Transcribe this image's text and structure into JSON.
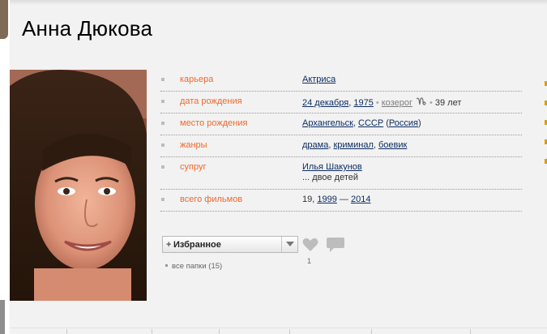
{
  "person": {
    "name": "Анна Дюкова"
  },
  "info": {
    "career": {
      "label": "карьера",
      "value": "Актриса"
    },
    "birth_date": {
      "label": "дата рождения",
      "day_month": "24 декабря",
      "year": "1975",
      "zodiac": "козерог",
      "age": "39 лет"
    },
    "birth_place": {
      "label": "место рождения",
      "city": "Архангельск",
      "country": "СССР",
      "country_now": "Россия"
    },
    "genres": {
      "label": "жанры",
      "items": [
        "драма",
        "криминал",
        "боевик"
      ]
    },
    "spouse": {
      "label": "супруг",
      "name": "Илья Шакунов",
      "children": "... двое детей"
    },
    "films_total": {
      "label": "всего фильмов",
      "count": "19",
      "year_from": "1999",
      "year_to": "2014"
    }
  },
  "favorites": {
    "plus": "+",
    "label": "Избранное",
    "folders_text": "все папки (15)"
  },
  "likes": {
    "count": "1"
  },
  "icons": {
    "dropdown": "chevron-down-icon",
    "heart": "heart-icon",
    "comment": "speech-bubble-icon",
    "zodiac": "capricorn-icon"
  },
  "colors": {
    "label_orange": "#f06a28",
    "link_navy": "#0c2d63",
    "page_bg": "#f2f2f2"
  }
}
